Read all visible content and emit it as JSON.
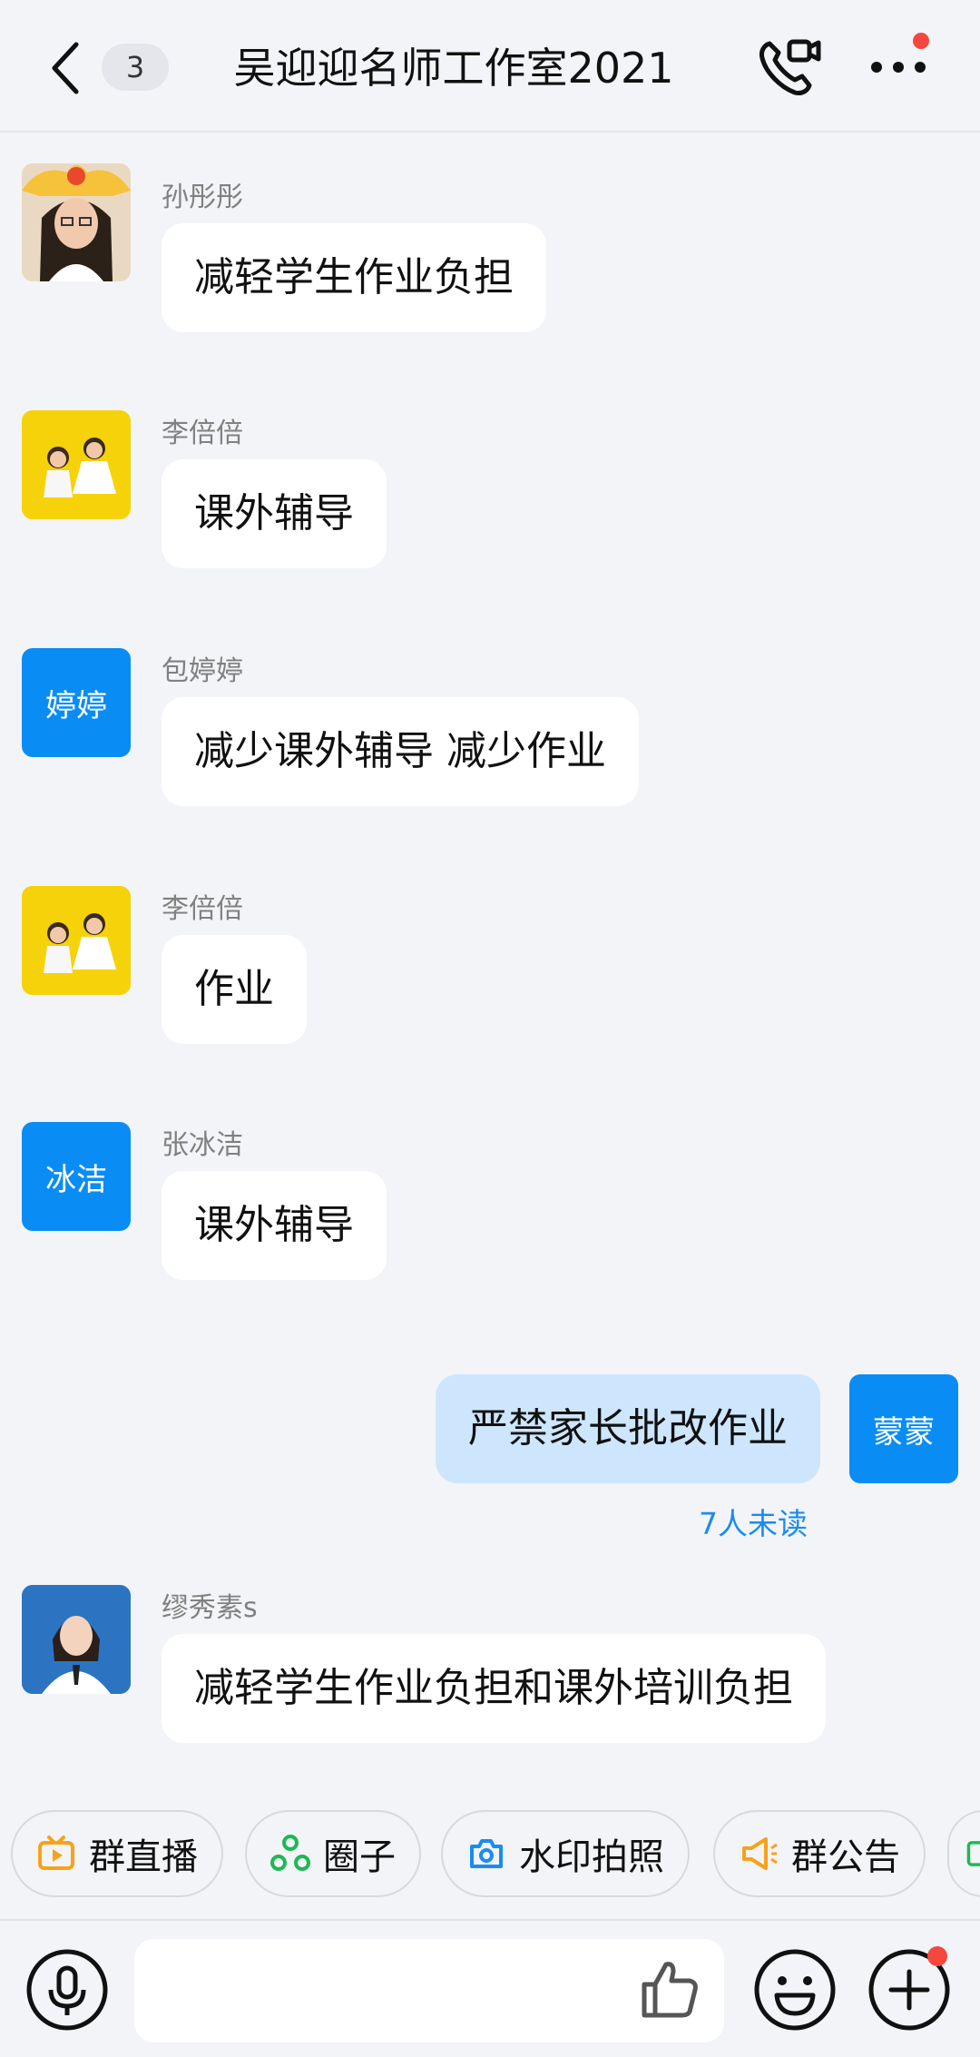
{
  "header": {
    "badge_count": "3",
    "title": "吴迎迎名师工作室2021",
    "icons": [
      "back-icon",
      "video-call-icon",
      "more-icon"
    ]
  },
  "messages": [
    {
      "sender": "孙彤彤",
      "text": "减轻学生作业负担",
      "avatar": "photo"
    },
    {
      "sender": "李倍倍",
      "text": "课外辅导",
      "avatar": "photo"
    },
    {
      "sender": "包婷婷",
      "text": "减少课外辅导 减少作业",
      "avatar_text": "婷婷"
    },
    {
      "sender": "李倍倍",
      "text": "作业",
      "avatar": "photo"
    },
    {
      "sender": "张冰洁",
      "text": "课外辅导",
      "avatar_text": "冰洁"
    },
    {
      "sender": "缪秀素s",
      "text": "减轻学生作业负担和课外培训负担",
      "avatar": "photo"
    }
  ],
  "my_message": {
    "text": "严禁家长批改作业",
    "avatar_text": "蒙蒙",
    "read_status": "7人未读"
  },
  "toolbar": {
    "chips": [
      {
        "label": "群直播",
        "icon": "live-tv-icon",
        "color": "#f7a21b"
      },
      {
        "label": "圈子",
        "icon": "circle-group-icon",
        "color": "#1db954"
      },
      {
        "label": "水印拍照",
        "icon": "camera-icon",
        "color": "#1a8cf0"
      },
      {
        "label": "群公告",
        "icon": "megaphone-icon",
        "color": "#f7a21b"
      }
    ]
  },
  "input": {
    "icons": [
      "voice-icon",
      "thumbs-up-icon",
      "emoji-icon",
      "plus-icon"
    ]
  },
  "colors": {
    "accent": "#0a8cf5",
    "my_bubble": "#cde6fd",
    "badge_red": "#f5473f"
  }
}
